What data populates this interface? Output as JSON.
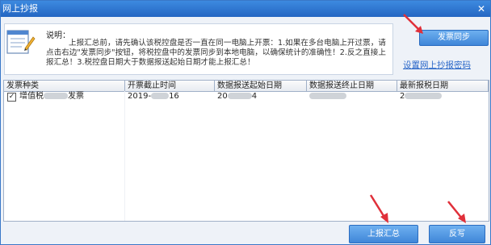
{
  "window": {
    "title": "网上抄报",
    "close_glyph": "✕"
  },
  "info": {
    "label": "说明：",
    "text": "上报汇总前，请先确认该税控盘是否一直在同一电脑上开票：1.如果在多台电脑上开过票，请点击右边\"发票同步\"按钮，将税控盘中的发票同步到本地电脑，以确保统计的准确性！2.反之直接上报汇总！3.税控盘日期大于数据报送起始日期才能上报汇总！"
  },
  "buttons": {
    "sync": "发票同步",
    "upload": "上报汇总",
    "writeback": "反写"
  },
  "link": {
    "password": "设置网上抄报密码"
  },
  "table": {
    "headers": [
      "发票种类",
      "开票截止时间",
      "数据报送起始日期",
      "数据报送终止日期",
      "最新报税日期"
    ],
    "rows": [
      {
        "checked": true,
        "type_a": "增值税",
        "type_b": "发票",
        "deadline_a": "2019-",
        "deadline_b": "16",
        "start_a": "20",
        "start_b": "4",
        "end": "",
        "latest": "2"
      }
    ]
  },
  "colors": {
    "accent": "#2466c2",
    "arrow": "#e0303a",
    "link": "#2a67c8"
  }
}
